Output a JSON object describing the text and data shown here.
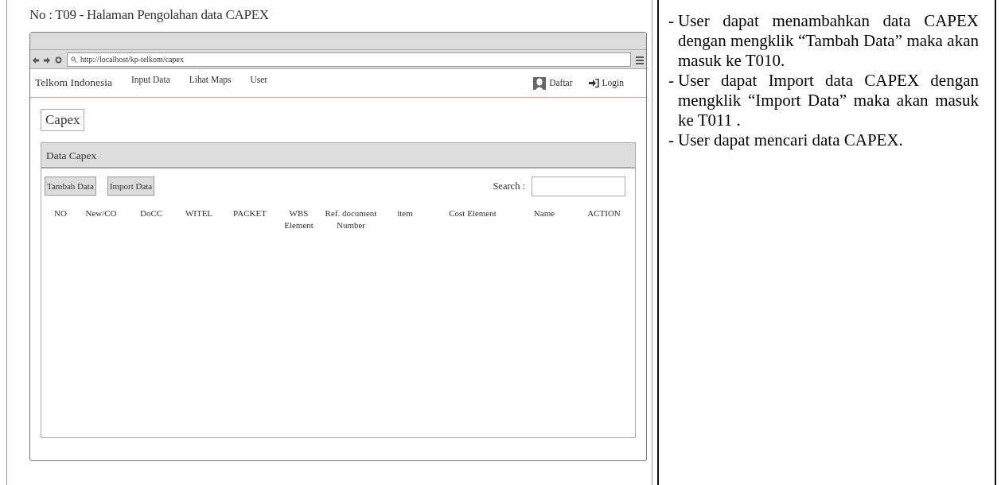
{
  "page_title": "No : T09 - Halaman Pengolahan data CAPEX",
  "browser": {
    "url": "http://localhost/kp-telkom/capex"
  },
  "navbar": {
    "brand": "Telkom Indonesia",
    "links": [
      "Input Data",
      "Lihat Maps",
      "User"
    ],
    "right": [
      {
        "kind": "register",
        "label": "Daftar"
      },
      {
        "kind": "login",
        "label": "Login"
      }
    ]
  },
  "page_heading": "Capex",
  "panel": {
    "title": "Data Capex",
    "buttons": [
      "Tambah Data",
      "Import Data"
    ],
    "search_label": "Search :",
    "columns": [
      "NO",
      "New/CO",
      "DoCC",
      "WITEL",
      "PACKET",
      "WBS Element",
      "Ref. document Number",
      "item",
      "Cost Element",
      "Name",
      "ACTION"
    ]
  },
  "description": [
    {
      "marker": "-",
      "text": "User dapat menambahkan data CAPEX dengan mengklik “Tambah Data” maka akan masuk ke T010."
    },
    {
      "marker": "-",
      "text": "User dapat Import data CAPEX dengan mengklik “Import Data” maka akan masuk ke T011 ."
    },
    {
      "marker": "-",
      "text": "User dapat mencari data CAPEX."
    }
  ]
}
